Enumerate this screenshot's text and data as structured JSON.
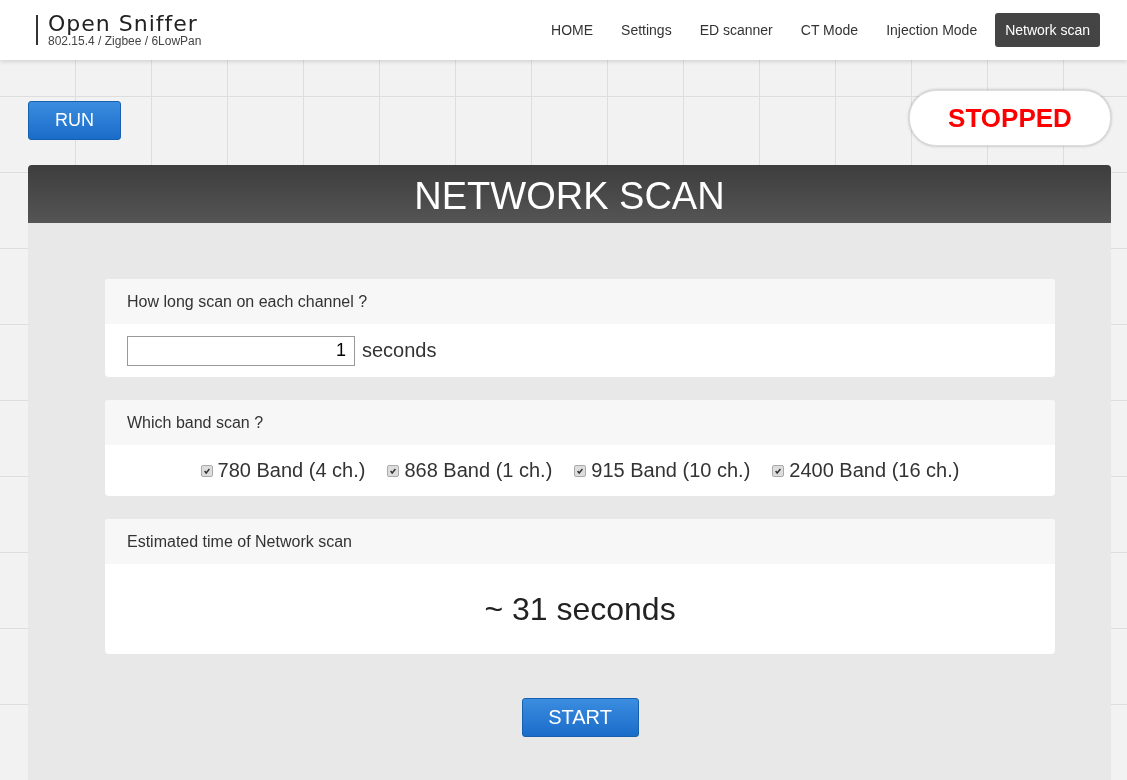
{
  "logo": {
    "title": "Open Sniffer",
    "subtitle": "802.15.4 / Zigbee / 6LowPan"
  },
  "nav": [
    {
      "label": "HOME",
      "selected": false
    },
    {
      "label": "Settings",
      "selected": false
    },
    {
      "label": "ED scanner",
      "selected": false
    },
    {
      "label": "CT Mode",
      "selected": false
    },
    {
      "label": "Injection Mode",
      "selected": false
    },
    {
      "label": "Network scan",
      "selected": true
    }
  ],
  "run_button": "RUN",
  "status": "STOPPED",
  "panel": {
    "title": "NETWORK SCAN",
    "duration": {
      "question": "How long scan on each channel ?",
      "value": "1",
      "unit": "seconds"
    },
    "bands": {
      "question": "Which band scan ?",
      "items": [
        {
          "label": "780 Band (4 ch.)",
          "checked": true
        },
        {
          "label": "868 Band (1 ch.)",
          "checked": true
        },
        {
          "label": "915 Band (10 ch.)",
          "checked": true
        },
        {
          "label": "2400 Band (16 ch.)",
          "checked": true
        }
      ]
    },
    "estimate": {
      "question": "Estimated time of Network scan",
      "value": "~ 31 seconds"
    },
    "start_button": "START"
  }
}
